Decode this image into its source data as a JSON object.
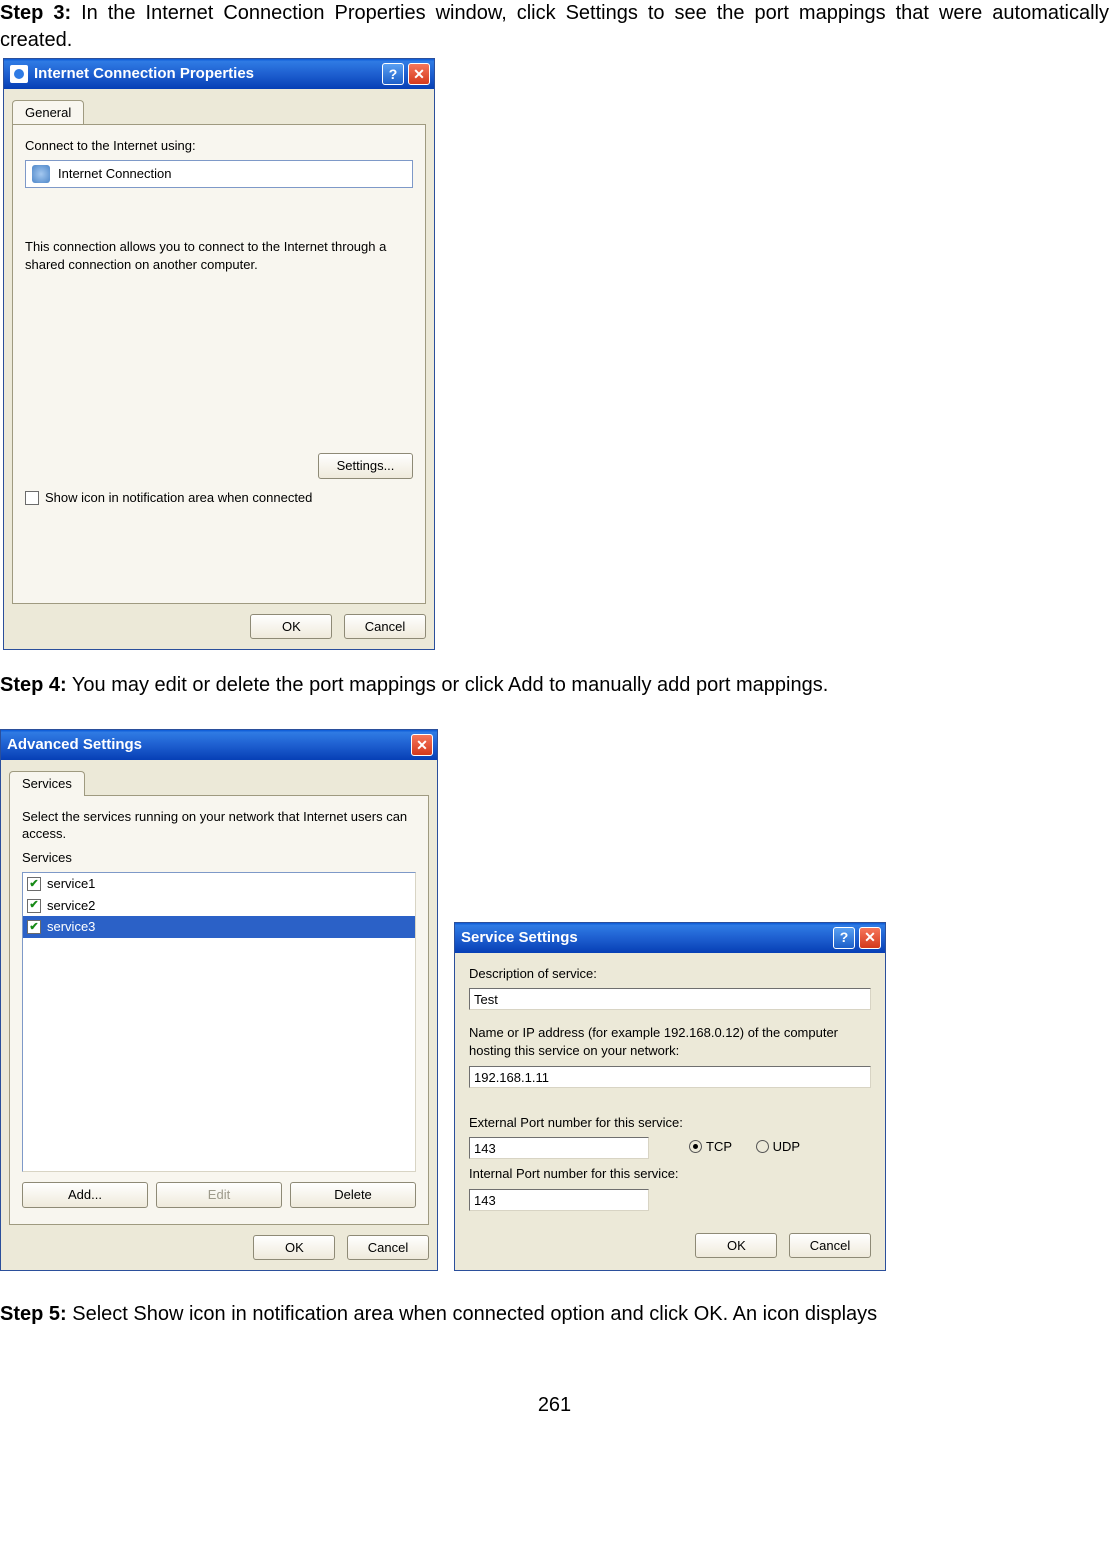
{
  "step3": {
    "label": "Step 3:",
    "text": " In the Internet Connection Properties window, click Settings to see the port mappings that were automatically created."
  },
  "icp": {
    "title": "Internet Connection Properties",
    "tab": "General",
    "connectLabel": "Connect to the Internet using:",
    "connectionName": "Internet Connection",
    "description": "This connection allows you to connect to the Internet through a shared connection on another computer.",
    "settingsBtn": "Settings...",
    "showIcon": "Show icon in notification area when connected",
    "ok": "OK",
    "cancel": "Cancel"
  },
  "step4": {
    "label": "Step 4:",
    "text": " You may edit or delete the port mappings or click Add to manually add port mappings."
  },
  "adv": {
    "title": "Advanced Settings",
    "tab": "Services",
    "intro": "Select the services running on your network that Internet users can access.",
    "servicesLabel": "Services",
    "items": [
      "service1",
      "service2",
      "service3"
    ],
    "add": "Add...",
    "edit": "Edit",
    "delete": "Delete",
    "ok": "OK",
    "cancel": "Cancel"
  },
  "svc": {
    "title": "Service Settings",
    "descLabel": "Description of service:",
    "descVal": "Test",
    "hostLabel": "Name or IP address (for example 192.168.0.12) of the computer hosting this service on your network:",
    "hostVal": "192.168.1.11",
    "extLabel": "External Port number for this service:",
    "extVal": "143",
    "tcp": "TCP",
    "udp": "UDP",
    "intLabel": "Internal Port number for this service:",
    "intVal": "143",
    "ok": "OK",
    "cancel": "Cancel"
  },
  "step5": {
    "label": "Step 5:",
    "text": " Select Show icon in notification area when connected option and click OK. An icon displays"
  },
  "pageNumber": "261"
}
